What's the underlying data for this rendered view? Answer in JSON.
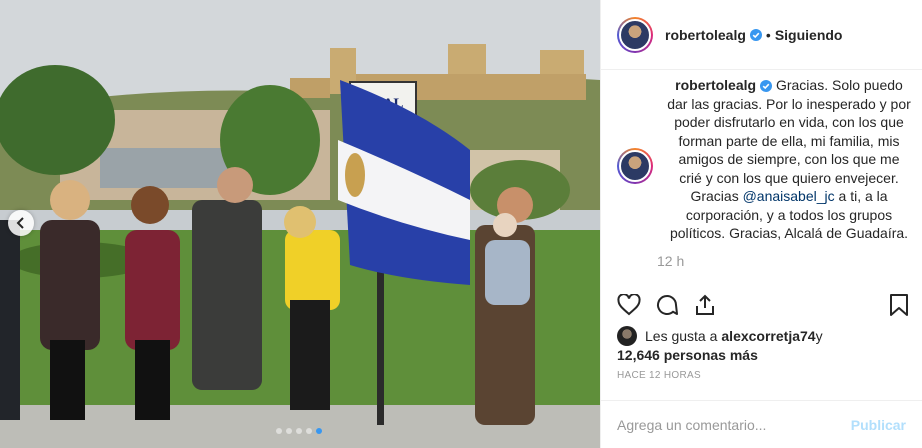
{
  "post": {
    "username": "robertolealg",
    "follow_status": "Siguiendo",
    "separator": "•",
    "caption_text": "Gracias. Solo puedo dar las gracias. Por lo inesperado y por poder disfrutarlo en vida, con los que forman parte de ella, mi familia, mis amigos de siempre, con los que me crié y con los que quiero envejecer. Gracias ",
    "mention": "@anaisabel_jc",
    "caption_tail": " a ti, a la corporación, y a todos los grupos políticos. Gracias, Alcalá de Guadaíra.",
    "caption_time": "12 h",
    "likes_prefix": "Les gusta a ",
    "likes_user": "alexcorretja74",
    "likes_and": " y",
    "likes_count": "12,646 personas más",
    "posted_ago": "HACE 12 HORAS",
    "sign_text": "LEAL"
  },
  "comment_box": {
    "placeholder": "Agrega un comentario...",
    "publish_label": "Publicar"
  },
  "carousel": {
    "total": 5,
    "active_index": 4
  },
  "icons": {
    "verified": "verified-badge-icon",
    "like": "heart-icon",
    "comment": "comment-icon",
    "share": "share-icon",
    "save": "bookmark-icon",
    "prev": "chevron-left-icon"
  },
  "colors": {
    "verified": "#3897f0",
    "mention": "#003569",
    "publish_disabled": "#b2dffc",
    "flag_blue": "#2840a8"
  }
}
